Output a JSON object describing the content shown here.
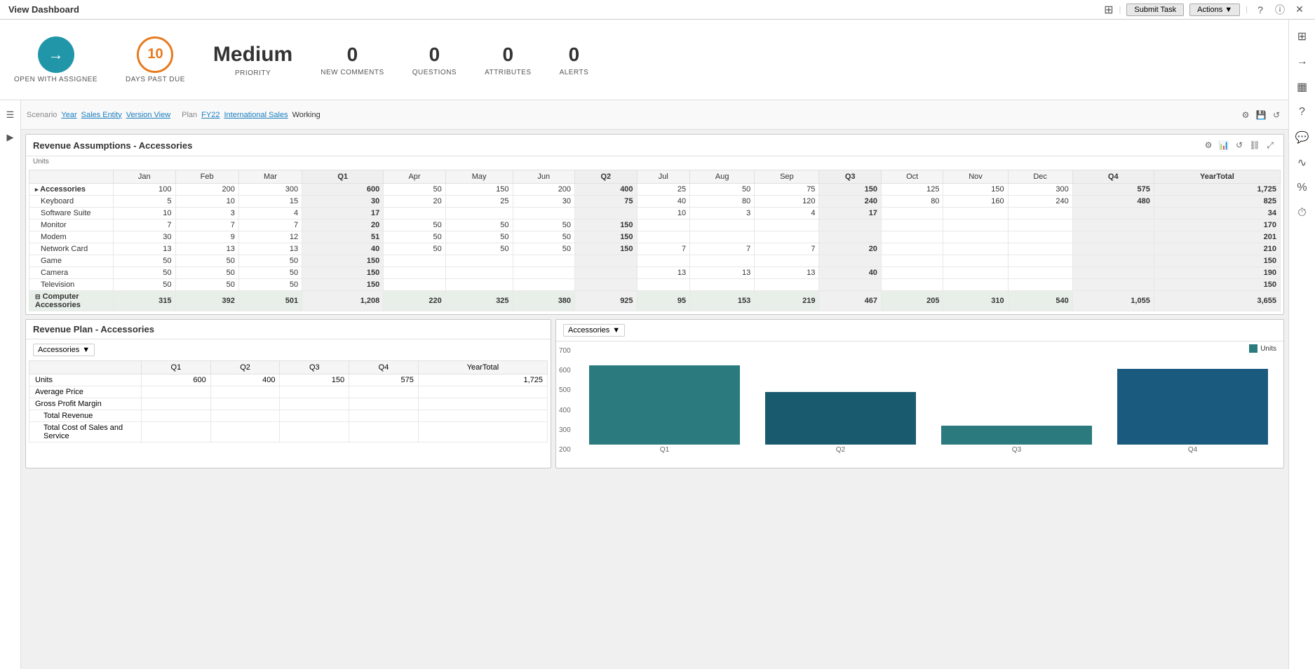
{
  "topbar": {
    "title": "View Dashboard",
    "submit_task": "Submit Task",
    "actions": "Actions ▼"
  },
  "metrics": {
    "open_with_assignee": "OPEN WITH ASSIGNEE",
    "days_past_due_label": "DAYS PAST DUE",
    "days_past_due_value": "10",
    "priority_label": "PRIORITY",
    "priority_value": "Medium",
    "new_comments_label": "NEW COMMENTS",
    "new_comments_value": "0",
    "questions_label": "QUESTIONS",
    "questions_value": "0",
    "attributes_label": "ATTRIBUTES",
    "attributes_value": "0",
    "alerts_label": "ALERTS",
    "alerts_value": "0"
  },
  "scenario": {
    "scenario_label": "Scenario",
    "year_label": "Year",
    "year_value": "FY22",
    "sales_entity_label": "Sales Entity",
    "sales_entity_value": "International Sales",
    "version_view_label": "Version View",
    "version_view_value": "Working",
    "plan_label": "Plan"
  },
  "revenue_assumptions": {
    "title": "Revenue Assumptions - Accessories",
    "subtitle": "Units",
    "columns": [
      "",
      "Jan",
      "Feb",
      "Mar",
      "Q1",
      "Apr",
      "May",
      "Jun",
      "Q2",
      "Jul",
      "Aug",
      "Sep",
      "Q3",
      "Oct",
      "Nov",
      "Dec",
      "Q4",
      "YearTotal"
    ],
    "rows": [
      {
        "label": "Accessories",
        "indent": false,
        "vals": [
          100,
          200,
          300,
          600,
          50,
          150,
          200,
          400,
          25,
          50,
          75,
          150,
          125,
          150,
          300,
          575,
          "1,725"
        ]
      },
      {
        "label": "Keyboard",
        "indent": true,
        "vals": [
          5,
          10,
          15,
          30,
          20,
          25,
          30,
          75,
          40,
          80,
          120,
          240,
          80,
          160,
          240,
          480,
          825
        ]
      },
      {
        "label": "Software Suite",
        "indent": true,
        "vals": [
          10,
          3,
          4,
          17,
          "",
          "",
          "",
          "",
          10,
          3,
          4,
          17,
          "",
          "",
          "",
          "",
          34
        ]
      },
      {
        "label": "Monitor",
        "indent": true,
        "vals": [
          7,
          7,
          7,
          20,
          50,
          50,
          50,
          150,
          "",
          "",
          "",
          "",
          "",
          "",
          "",
          "",
          170
        ]
      },
      {
        "label": "Modem",
        "indent": true,
        "vals": [
          30,
          9,
          12,
          51,
          50,
          50,
          50,
          150,
          "",
          "",
          "",
          "",
          "",
          "",
          "",
          "",
          201
        ]
      },
      {
        "label": "Network Card",
        "indent": true,
        "vals": [
          13,
          13,
          13,
          40,
          50,
          50,
          50,
          150,
          7,
          7,
          7,
          20,
          "",
          "",
          "",
          "",
          210
        ]
      },
      {
        "label": "Game",
        "indent": true,
        "vals": [
          50,
          50,
          50,
          150,
          "",
          "",
          "",
          "",
          "",
          "",
          "",
          "",
          "",
          "",
          "",
          "",
          150
        ]
      },
      {
        "label": "Camera",
        "indent": true,
        "vals": [
          50,
          50,
          50,
          150,
          "",
          "",
          "",
          "",
          13,
          13,
          13,
          40,
          "",
          "",
          "",
          "",
          190
        ]
      },
      {
        "label": "Television",
        "indent": true,
        "vals": [
          50,
          50,
          50,
          150,
          "",
          "",
          "",
          "",
          "",
          "",
          "",
          "",
          "",
          "",
          "",
          "",
          150
        ]
      },
      {
        "label": "Computer Accessories",
        "total": true,
        "vals": [
          315,
          392,
          501,
          "1,208",
          220,
          325,
          380,
          925,
          95,
          153,
          219,
          467,
          205,
          310,
          540,
          "1,055",
          "3,655"
        ]
      }
    ]
  },
  "revenue_plan": {
    "title": "Revenue Plan - Accessories",
    "dropdown": "Accessories",
    "columns": [
      "",
      "Q1",
      "Q2",
      "Q3",
      "Q4",
      "YearTotal"
    ],
    "rows": [
      {
        "label": "Units",
        "vals": [
          600,
          400,
          150,
          575,
          "1,725"
        ]
      },
      {
        "label": "Average Price",
        "vals": [
          "",
          "",
          "",
          "",
          ""
        ]
      },
      {
        "label": "Gross Profit Margin",
        "vals": [
          "",
          "",
          "",
          "",
          ""
        ]
      },
      {
        "label": "Total Revenue",
        "indent": true,
        "vals": [
          "",
          "",
          "",
          "",
          ""
        ]
      },
      {
        "label": "Total Cost of Sales and Service",
        "indent": true,
        "vals": [
          "",
          "",
          "",
          "",
          ""
        ]
      }
    ]
  },
  "chart": {
    "title": "Accessories",
    "y_labels": [
      "700",
      "600",
      "500",
      "400",
      "300",
      "200"
    ],
    "bars": [
      {
        "quarter": "Q1",
        "height_pct": 87,
        "color": "#2a7a7e"
      },
      {
        "quarter": "Q2",
        "height_pct": 58,
        "color": "#1a5a6e"
      },
      {
        "quarter": "Q3",
        "height_pct": 21,
        "color": "#2a7a7e"
      },
      {
        "quarter": "Q4",
        "height_pct": 83,
        "color": "#1a5a7e"
      }
    ],
    "legend": "Units"
  },
  "right_panel_icons": [
    "≡",
    "→",
    "⊞",
    "?",
    "💬",
    "∿",
    "%",
    "🕐"
  ],
  "left_nav_icons": [
    "☰",
    "↓",
    "←"
  ]
}
